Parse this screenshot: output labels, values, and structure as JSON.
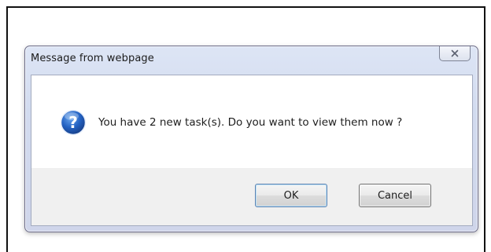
{
  "dialog": {
    "title": "Message from webpage",
    "message": "You have 2 new task(s). Do you want to view them now ?",
    "icon": "question-icon",
    "ok_label": "OK",
    "cancel_label": "Cancel",
    "close_icon": "close-icon"
  },
  "colors": {
    "icon_blue": "#1f5fb8",
    "frame": "#cfd6ea"
  }
}
